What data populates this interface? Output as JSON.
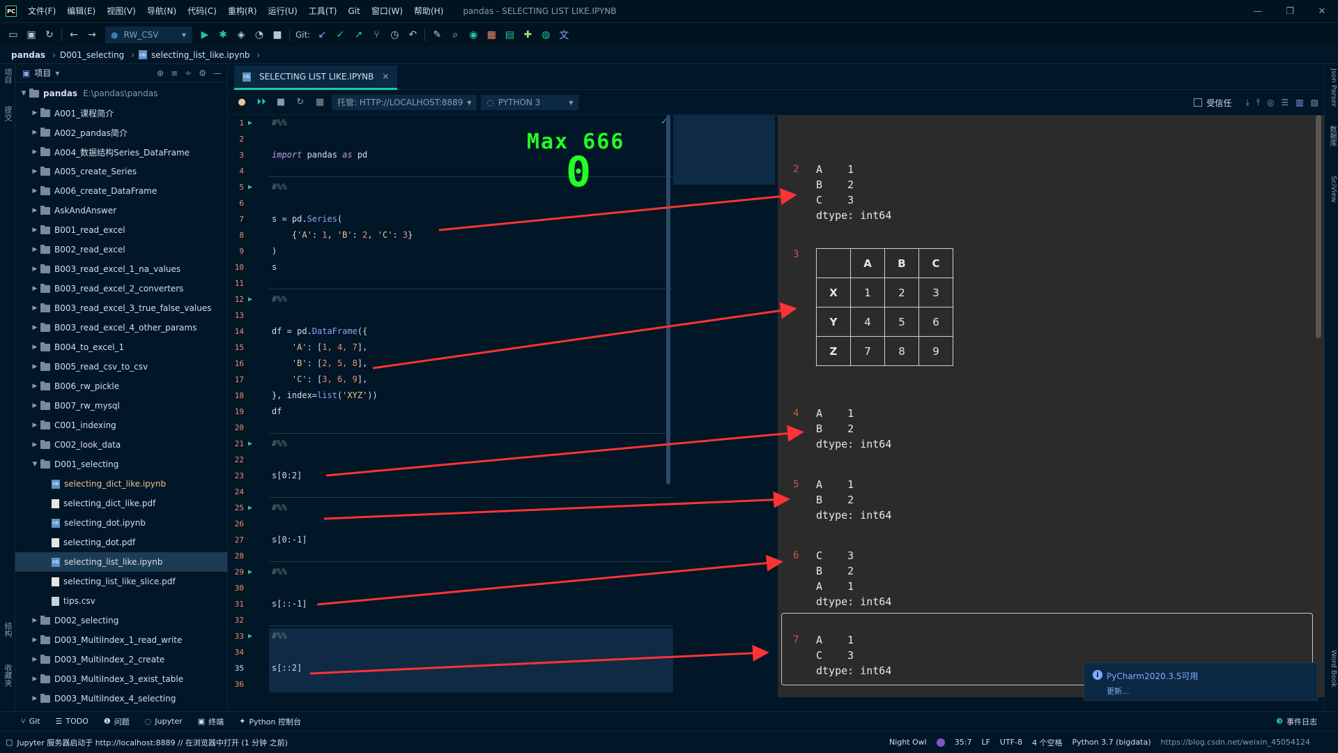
{
  "window": {
    "title": "pandas - SELECTING LIST LIKE.IPYNB",
    "menu": [
      "文件(F)",
      "编辑(E)",
      "视图(V)",
      "导航(N)",
      "代码(C)",
      "重构(R)",
      "运行(U)",
      "工具(T)",
      "Git",
      "窗口(W)",
      "帮助(H)"
    ],
    "controls": {
      "minimize": "—",
      "restore": "❐",
      "close": "✕"
    }
  },
  "toolbar": {
    "run_config": "RW_CSV",
    "git_label": "Git:"
  },
  "breadcrumb": [
    "pandas",
    "D001_selecting",
    "selecting_list_like.ipynb"
  ],
  "project_panel": {
    "title": "项目",
    "root": {
      "name": "pandas",
      "path": "E:\\pandas\\pandas"
    },
    "items": [
      {
        "label": "A001_课程简介",
        "type": "folder"
      },
      {
        "label": "A002_pandas简介",
        "type": "folder"
      },
      {
        "label": "A004_数据结构Series_DataFrame",
        "type": "folder"
      },
      {
        "label": "A005_create_Series",
        "type": "folder"
      },
      {
        "label": "A006_create_DataFrame",
        "type": "folder"
      },
      {
        "label": "AskAndAnswer",
        "type": "folder"
      },
      {
        "label": "B001_read_excel",
        "type": "folder"
      },
      {
        "label": "B002_read_excel",
        "type": "folder"
      },
      {
        "label": "B003_read_excel_1_na_values",
        "type": "folder"
      },
      {
        "label": "B003_read_excel_2_converters",
        "type": "folder"
      },
      {
        "label": "B003_read_excel_3_true_false_values",
        "type": "folder"
      },
      {
        "label": "B003_read_excel_4_other_params",
        "type": "folder"
      },
      {
        "label": "B004_to_excel_1",
        "type": "folder"
      },
      {
        "label": "B005_read_csv_to_csv",
        "type": "folder"
      },
      {
        "label": "B006_rw_pickle",
        "type": "folder"
      },
      {
        "label": "B007_rw_mysql",
        "type": "folder"
      },
      {
        "label": "C001_indexing",
        "type": "folder"
      },
      {
        "label": "C002_look_data",
        "type": "folder"
      },
      {
        "label": "D001_selecting",
        "type": "folder-open"
      },
      {
        "label": "selecting_dict_like.ipynb",
        "type": "ipynb"
      },
      {
        "label": "selecting_dict_like.pdf",
        "type": "pdf"
      },
      {
        "label": "selecting_dot.ipynb",
        "type": "ipynb"
      },
      {
        "label": "selecting_dot.pdf",
        "type": "pdf"
      },
      {
        "label": "selecting_list_like.ipynb",
        "type": "ipynb"
      },
      {
        "label": "selecting_list_like_slice.pdf",
        "type": "pdf"
      },
      {
        "label": "tips.csv",
        "type": "csv"
      },
      {
        "label": "D002_selecting",
        "type": "folder"
      },
      {
        "label": "D003_MultiIndex_1_read_write",
        "type": "folder"
      },
      {
        "label": "D003_MultiIndex_2_create",
        "type": "folder"
      },
      {
        "label": "D003_MultiIndex_3_exist_table",
        "type": "folder"
      },
      {
        "label": "D003_MultiIndex_4_selecting",
        "type": "folder"
      }
    ]
  },
  "editor": {
    "tab_label": "SELECTING LIST LIKE.IPYNB",
    "host_label": "托管: HTTP://LOCALHOST:8889",
    "kernel_label": "PYTHON 3",
    "trusted_label": "受信任",
    "current_line": "35",
    "line_numbers": [
      "1",
      "2",
      "3",
      "4",
      "5",
      "6",
      "7",
      "8",
      "9",
      "10",
      "11",
      "12",
      "13",
      "14",
      "15",
      "16",
      "17",
      "18",
      "19",
      "20",
      "21",
      "22",
      "23",
      "24",
      "25",
      "26",
      "27",
      "28",
      "29",
      "30",
      "31",
      "32",
      "33",
      "34",
      "35",
      "36"
    ],
    "code": {
      "l1": "#%%",
      "l3_kw": "import",
      "l3_mid": " pandas ",
      "l3_as": "as",
      "l3_end": " pd",
      "l5": "#%%",
      "l7_a": "s = pd.",
      "l7_fn": "Series",
      "l7_b": "(",
      "l8_a": "    {",
      "l8_k1": "'A'",
      "l8_b": ": ",
      "l8_v1": "1",
      "l8_c": ", ",
      "l8_k2": "'B'",
      "l8_d": ": ",
      "l8_v2": "2",
      "l8_e": ", ",
      "l8_k3": "'C'",
      "l8_f": ": ",
      "l8_v3": "3",
      "l8_g": "}",
      "l9": ")",
      "l10": "s",
      "l12": "#%%",
      "l14_a": "df = pd.",
      "l14_fn": "DataFrame",
      "l14_b": "({",
      "l15_a": "    ",
      "l15_k": "'A'",
      "l15_b": ": [",
      "l15_v": "1, 4, 7",
      "l15_c": "],",
      "l16_a": "    ",
      "l16_k": "'B'",
      "l16_b": ": [",
      "l16_v": "2, 5, 8",
      "l16_c": "],",
      "l17_a": "    ",
      "l17_k": "'C'",
      "l17_b": ": [",
      "l17_v": "3, 6, 9",
      "l17_c": "],",
      "l18_a": "}, index=",
      "l18_fn": "list",
      "l18_b": "(",
      "l18_s": "'XYZ'",
      "l18_c": "))",
      "l19": "df",
      "l21": "#%%",
      "l23": "s[0:2]",
      "l25": "#%%",
      "l27": "s[0:-1]",
      "l29": "#%%",
      "l31": "s[::-1]",
      "l33": "#%%",
      "l35": "s[::2]"
    }
  },
  "outputs": [
    {
      "index": "2",
      "text": "A    1\nB    2\nC    3\ndtype: int64"
    },
    {
      "index": "3",
      "table": {
        "columns": [
          "A",
          "B",
          "C"
        ],
        "rows": [
          {
            "index": "X",
            "values": [
              "1",
              "2",
              "3"
            ]
          },
          {
            "index": "Y",
            "values": [
              "4",
              "5",
              "6"
            ]
          },
          {
            "index": "Z",
            "values": [
              "7",
              "8",
              "9"
            ]
          }
        ]
      }
    },
    {
      "index": "4",
      "text": "A    1\nB    2\ndtype: int64"
    },
    {
      "index": "5",
      "text": "A    1\nB    2\ndtype: int64"
    },
    {
      "index": "6",
      "text": "C    3\nB    2\nA    1\ndtype: int64"
    },
    {
      "index": "7",
      "text": "A    1\nC    3\ndtype: int64"
    }
  ],
  "overlay": {
    "label": "Max  666",
    "counter": "0"
  },
  "notification": {
    "title": "PyCharm2020.3.5可用",
    "link": "更新..."
  },
  "tool_windows": [
    "Git",
    "TODO",
    "问题",
    "Jupyter",
    "终端",
    "Python 控制台"
  ],
  "event_log": "事件日志",
  "status": {
    "message": "Jupyter 服务器启动于 http://localhost:8889 // 在浏览器中打开 (1 分钟 之前)",
    "theme": "Night Owl",
    "position": "35:7",
    "line_sep": "LF",
    "encoding": "UTF-8",
    "indent": "4 个空格",
    "interpreter": "Python 3.7 (bigdata)",
    "watermark": "https://blog.csdn.net/weixin_45054124"
  },
  "left_vertical_tabs": [
    "项目",
    "提交",
    "结构",
    "收藏夹"
  ],
  "right_vertical_tabs": [
    "Json Parser",
    "数据库",
    "SciView",
    "Word Book"
  ],
  "colors": {
    "background": "#011627",
    "output_bg": "#2b2b2b",
    "accent": "#21c7a8",
    "arrow": "#ff3333",
    "overlay": "#22ff22"
  }
}
